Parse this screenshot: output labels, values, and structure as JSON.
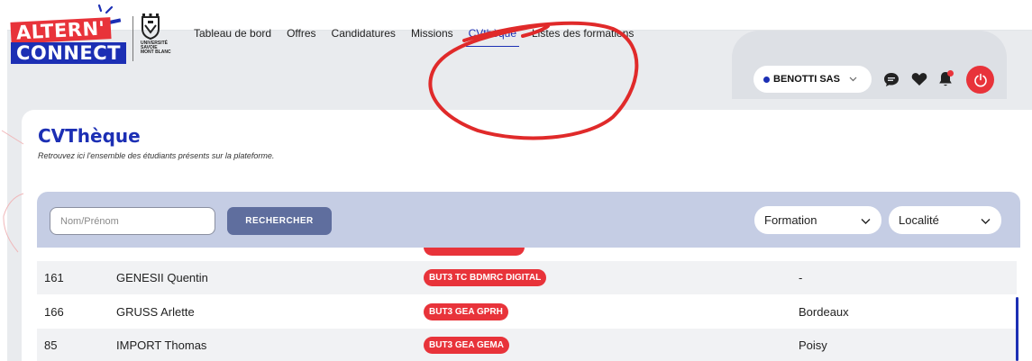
{
  "logo": {
    "line1": "ALTERN'",
    "line2": "CONNECT",
    "university": [
      "UNIVERSITÉ",
      "SAVOIE",
      "MONT BLANC"
    ]
  },
  "nav": {
    "items": [
      "Tableau de bord",
      "Offres",
      "Candidatures",
      "Missions",
      "CVthèque",
      "Listes des formations"
    ],
    "active": "CVthèque"
  },
  "account": {
    "company": "BENOTTI SAS"
  },
  "icons": {
    "chat": "chat-icon",
    "favorites": "heart-icon",
    "notifications": "bell-icon",
    "logout": "power-icon"
  },
  "colors": {
    "brand_blue": "#1c2fb4",
    "brand_red": "#e8333a",
    "filter_bar": "#c5cde4",
    "search_button": "#5f6e9e"
  },
  "page": {
    "title": "CVThèque",
    "subtitle": "Retrouvez ici l'ensemble des étudiants présents sur la plateforme."
  },
  "filters": {
    "search_placeholder": "Nom/Prénom",
    "search_button": "RECHERCHER",
    "formation_label": "Formation",
    "localite_label": "Localité"
  },
  "table": {
    "rows": [
      {
        "id": "161",
        "name": "GENESII Quentin",
        "formation": "BUT3 TC BDMRC DIGITAL",
        "location": "-"
      },
      {
        "id": "166",
        "name": "GRUSS Arlette",
        "formation": "BUT3 GEA GPRH",
        "location": "Bordeaux"
      },
      {
        "id": "85",
        "name": "IMPORT Thomas",
        "formation": "BUT3 GEA GEMA",
        "location": "Poisy"
      }
    ]
  }
}
